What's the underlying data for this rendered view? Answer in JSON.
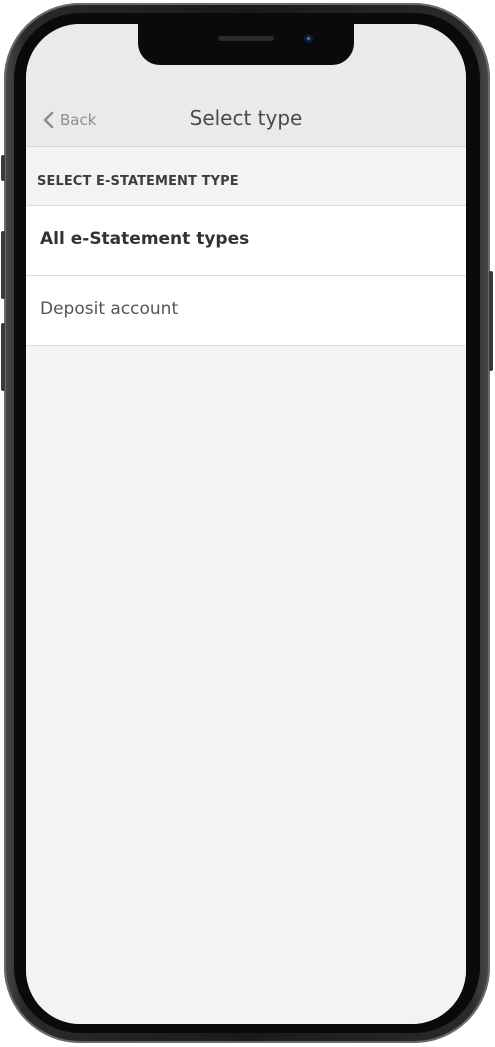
{
  "navbar": {
    "back_label": "Back",
    "title": "Select type",
    "back_icon": "chevron-left-icon"
  },
  "section": {
    "header": "SELECT E-STATEMENT TYPE"
  },
  "list": {
    "items": [
      {
        "label": "All e-Statement types",
        "selected": true
      },
      {
        "label": "Deposit account",
        "selected": false
      }
    ]
  },
  "colors": {
    "navbar_bg": "#eaeaea",
    "screen_bg": "#f3f3f3",
    "list_bg": "#ffffff",
    "back_text": "#8e8e8e",
    "divider": "#dcdcdc"
  }
}
